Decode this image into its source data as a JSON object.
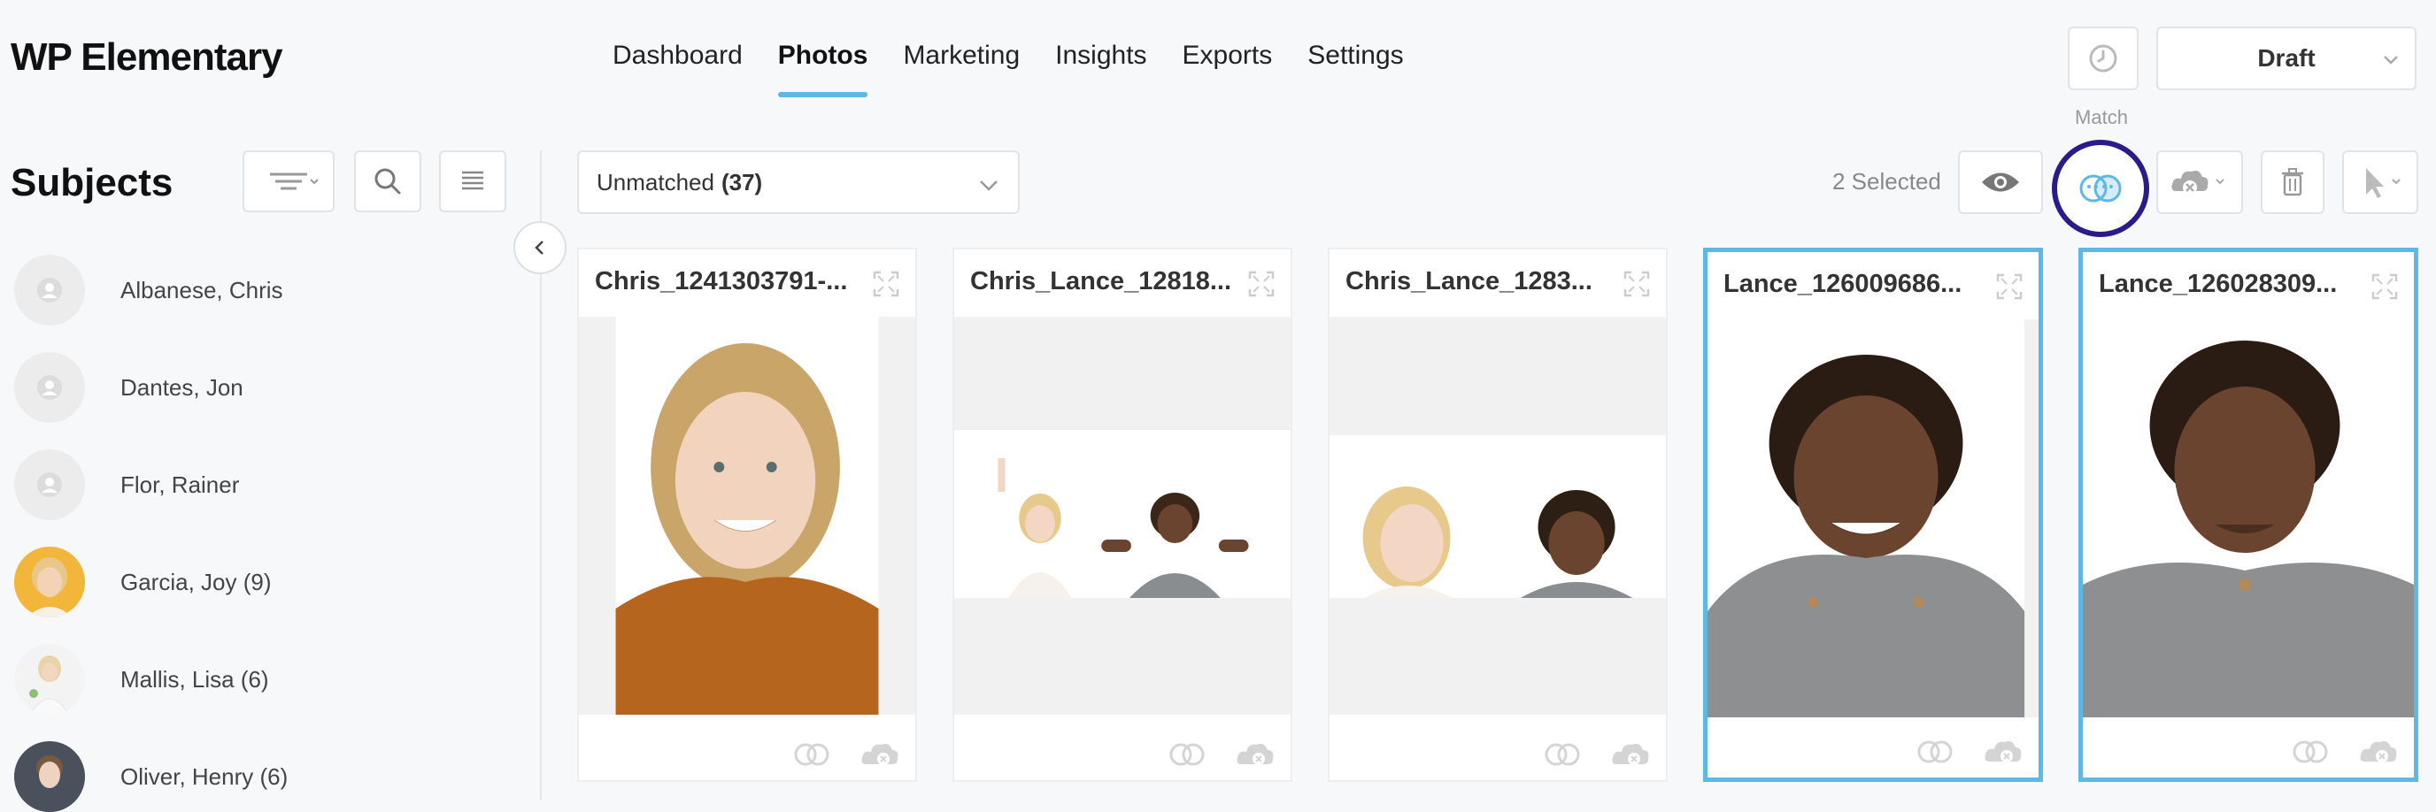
{
  "app": {
    "title": "WP Elementary"
  },
  "nav": {
    "items": [
      {
        "label": "Dashboard",
        "active": false
      },
      {
        "label": "Photos",
        "active": true
      },
      {
        "label": "Marketing",
        "active": false
      },
      {
        "label": "Insights",
        "active": false
      },
      {
        "label": "Exports",
        "active": false
      },
      {
        "label": "Settings",
        "active": false
      }
    ]
  },
  "header": {
    "status": "Draft",
    "match_label": "Match"
  },
  "sidebar": {
    "title": "Subjects",
    "subjects": [
      {
        "name": "Albanese, Chris",
        "avatar": "placeholder"
      },
      {
        "name": "Dantes, Jon",
        "avatar": "placeholder"
      },
      {
        "name": "Flor, Rainer",
        "avatar": "placeholder"
      },
      {
        "name": "Garcia, Joy (9)",
        "avatar": "photo"
      },
      {
        "name": "Mallis, Lisa (6)",
        "avatar": "photo"
      },
      {
        "name": "Oliver, Henry (6)",
        "avatar": "photo"
      }
    ]
  },
  "toolbar": {
    "filter_label": "Unmatched",
    "filter_count": "(37)",
    "selected_text": "2 Selected"
  },
  "photos": [
    {
      "title": "Chris_1241303791-...",
      "selected": false
    },
    {
      "title": "Chris_Lance_12818...",
      "selected": false
    },
    {
      "title": "Chris_Lance_1283...",
      "selected": false
    },
    {
      "title": "Lance_126009686...",
      "selected": true
    },
    {
      "title": "Lance_126028309...",
      "selected": true
    }
  ],
  "colors": {
    "accent": "#5db8e6",
    "highlight_ring": "#2a1a8a"
  }
}
